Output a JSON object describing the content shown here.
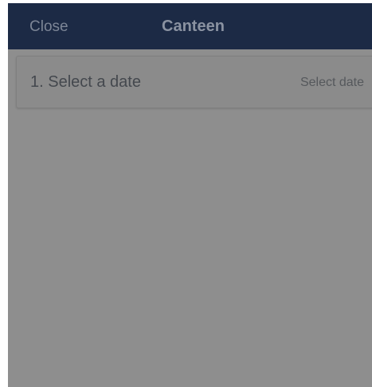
{
  "nav": {
    "close_label": "Close",
    "title": "Canteen"
  },
  "date_section": {
    "label": "1. Select a date",
    "value_placeholder": "Select date"
  },
  "colors": {
    "nav_background": "#1c2a45",
    "overlay_background": "#8e8e8e"
  }
}
